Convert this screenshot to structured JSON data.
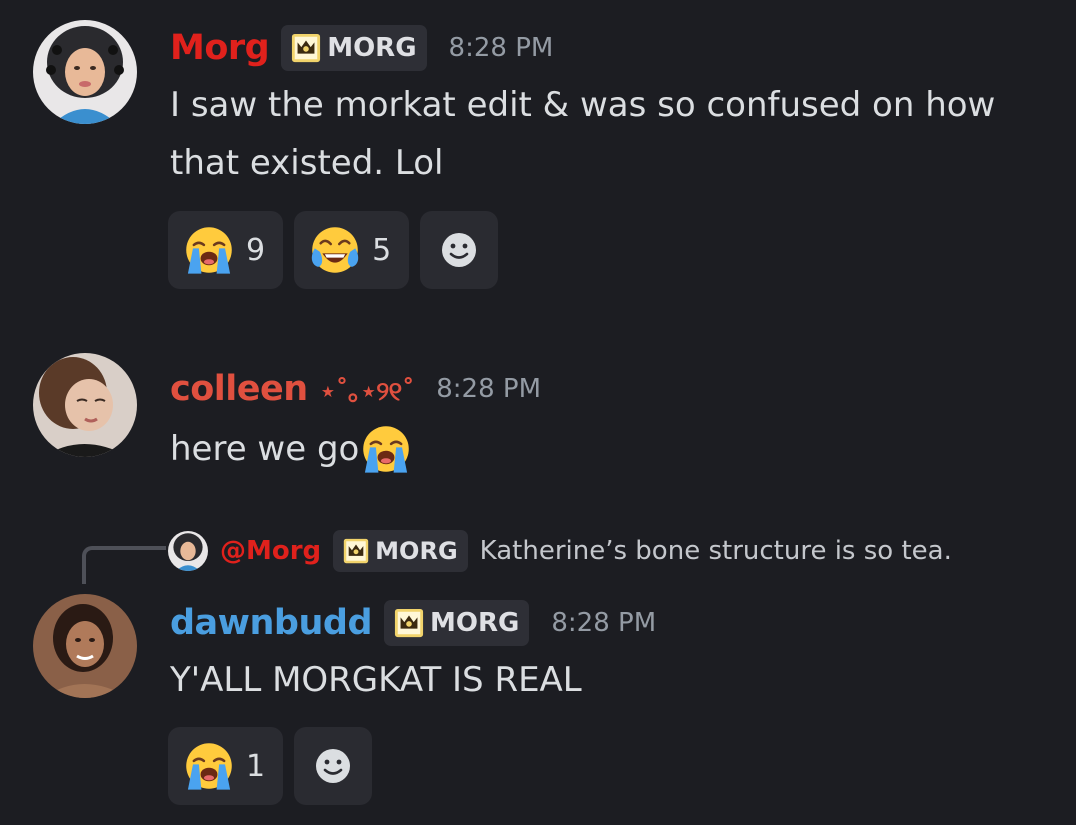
{
  "messages": [
    {
      "username": "Morg",
      "username_color": "#e0211c",
      "tag": "MORG",
      "tag_icon": "crown-icon",
      "time": "8:28 PM",
      "lines": [
        "I saw the morkat edit & was so confused on how",
        "that existed. Lol"
      ],
      "reactions": [
        {
          "emoji": "loudly-crying-face",
          "count": "9"
        },
        {
          "emoji": "tears-of-joy-face",
          "count": "5"
        }
      ]
    },
    {
      "username": "colleen",
      "username_suffix": "⋆˚｡⋆୨୧˚",
      "username_color": "#e0503f",
      "time": "8:28 PM",
      "text": "here we go"
    },
    {
      "reply_to": {
        "mention": "@Morg",
        "tag": "MORG",
        "text": "Katherine’s bone structure is so tea."
      },
      "username": "dawnbudd",
      "username_color": "#4a9ee0",
      "tag": "MORG",
      "time": "8:28 PM",
      "text": "Y'ALL MORGKAT IS REAL",
      "reactions": [
        {
          "emoji": "loudly-crying-face",
          "count": "1"
        }
      ]
    }
  ],
  "add_reaction_icon": "add-reaction-smiley-icon"
}
